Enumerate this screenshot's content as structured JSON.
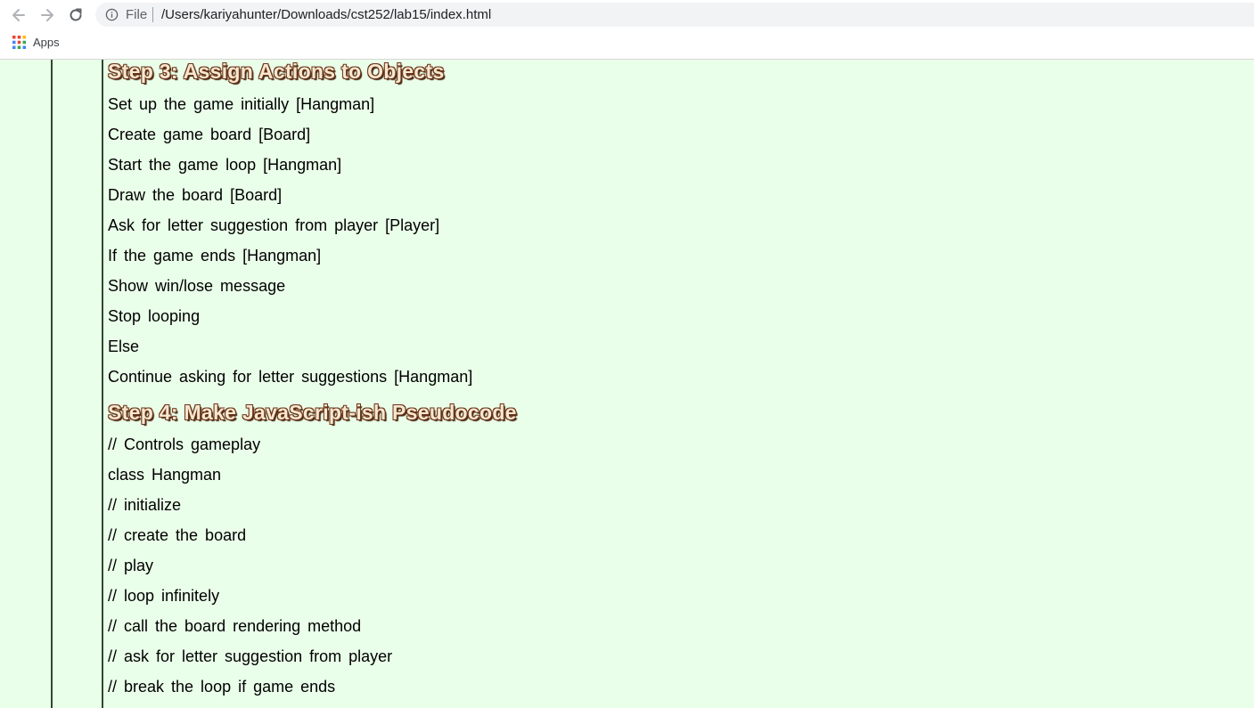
{
  "browser": {
    "back_icon": "arrow-left-icon",
    "forward_icon": "arrow-right-icon",
    "reload_icon": "reload-icon",
    "info_icon": "info-icon",
    "scheme_label": "File",
    "url": "/Users/kariyahunter/Downloads/cst252/lab15/index.html",
    "bookmarks": {
      "apps_icon": "apps-grid-icon",
      "apps_label": "Apps"
    }
  },
  "page": {
    "background_color": "#eaffea",
    "rail_color": "#2f4a2f",
    "step3": {
      "heading": "Step 3: Assign Actions to Objects",
      "lines": [
        "Set up the game initially [Hangman]",
        "Create game board [Board]",
        "Start the game loop [Hangman]",
        "Draw the board [Board]",
        "Ask for letter suggestion from player [Player]",
        "If the game ends [Hangman]",
        "Show win/lose message",
        "Stop looping",
        "Else",
        "Continue asking for letter suggestions [Hangman]"
      ]
    },
    "step4": {
      "heading": "Step 4: Make JavaScript-ish Pseudocode",
      "lines": [
        "// Controls gameplay",
        "class Hangman",
        "// initialize",
        "// create the board",
        "// play",
        "// loop infinitely",
        "// call the board rendering method",
        "// ask for letter suggestion from player",
        "// break the loop if game ends"
      ]
    }
  }
}
